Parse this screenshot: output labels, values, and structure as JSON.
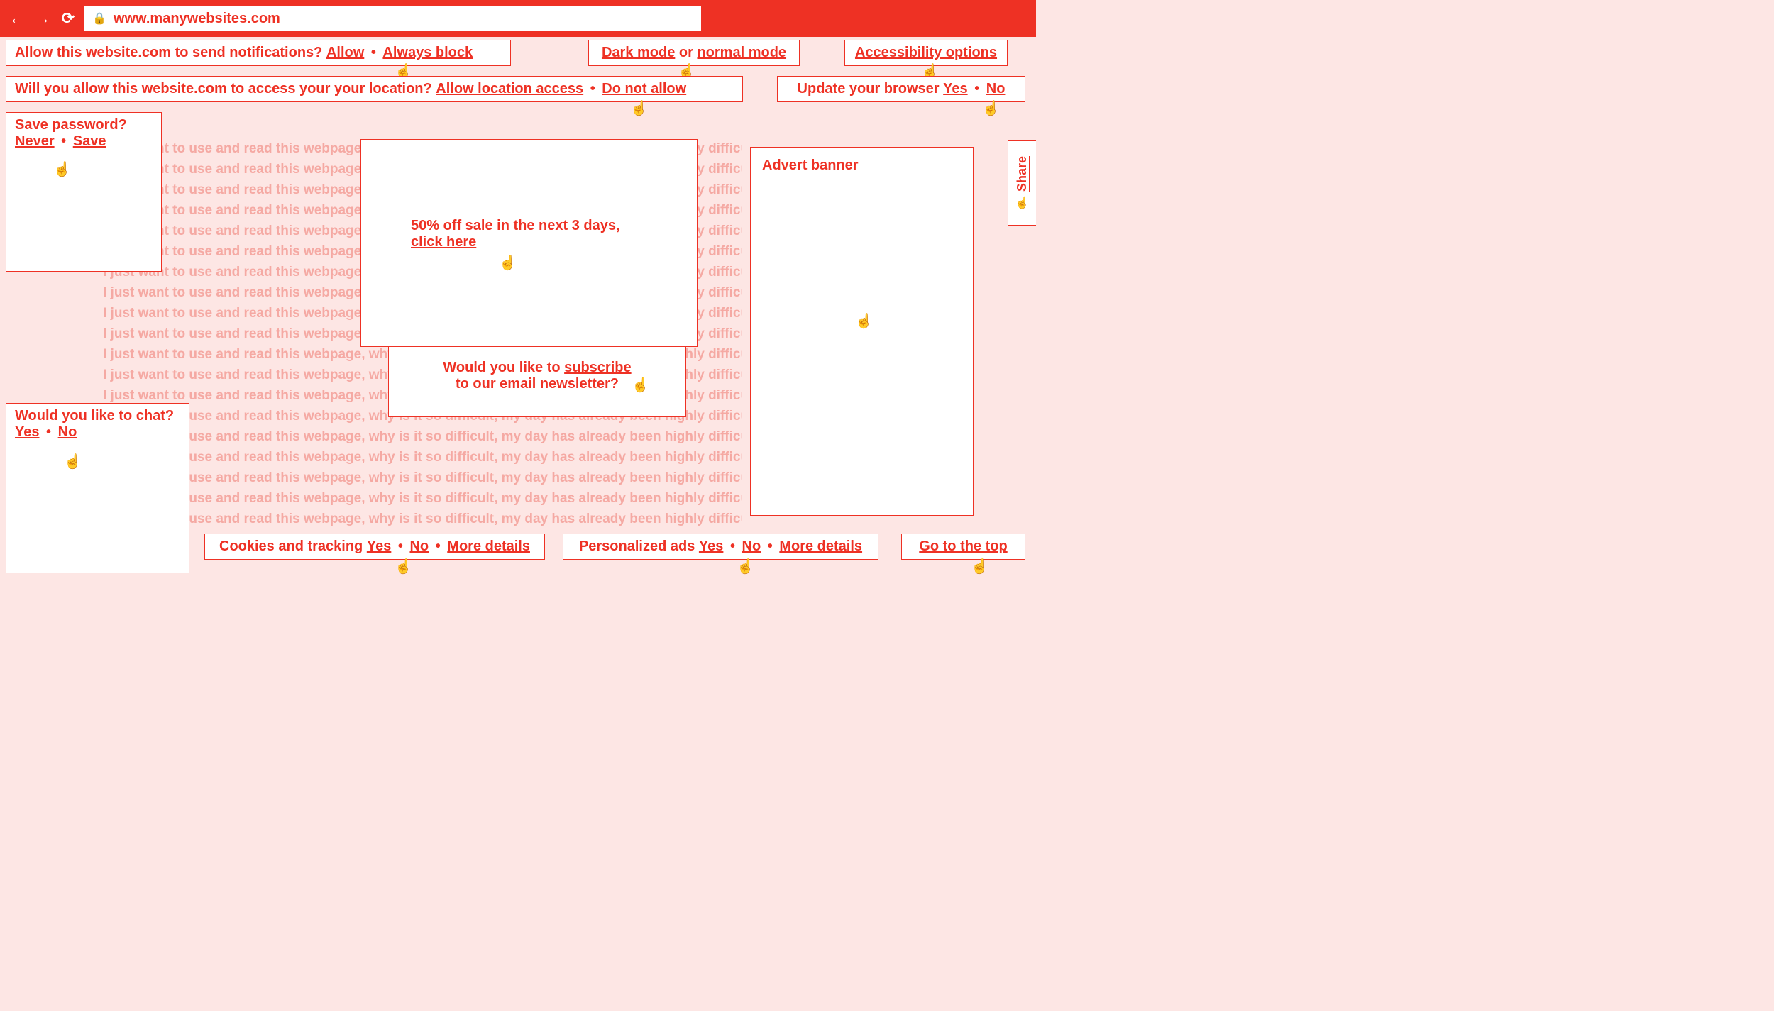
{
  "url": "www.manywebsites.com",
  "prompts": {
    "notifications": {
      "text": "Allow this website.com to send notifications? ",
      "allow": "Allow",
      "block": "Always block"
    },
    "darkmode": {
      "dark": "Dark mode",
      "or": " or ",
      "normal": "normal mode"
    },
    "accessibility": {
      "label": "Accessibility options"
    },
    "location": {
      "text": "Will you allow this website.com to access your your location? ",
      "allow": "Allow location access",
      "deny": "Do not allow"
    },
    "update": {
      "text": "Update your browser ",
      "yes": "Yes",
      "no": "No"
    },
    "password": {
      "text": "Save password?",
      "never": "Never",
      "save": "Save"
    },
    "chat": {
      "text": "Would you like to chat?",
      "yes": "Yes",
      "no": "No"
    },
    "cookies": {
      "text": "Cookies and tracking ",
      "yes": "Yes",
      "no": "No",
      "more": "More details"
    },
    "ads": {
      "text": "Personalized ads ",
      "yes": "Yes",
      "no": "No",
      "more": "More details"
    },
    "top": {
      "label": "Go to the top"
    },
    "sale": {
      "text": "50% off sale in the next 3 days, ",
      "link": "click here"
    },
    "subscribe": {
      "text1": "Would you like to ",
      "link": "subscribe",
      "text2": "to our email newsletter?"
    },
    "advert": "Advert banner",
    "share": "Share"
  },
  "bg_line": "I just want to use and read this webpage, why is it so difficult, my day has already been highly difficult"
}
